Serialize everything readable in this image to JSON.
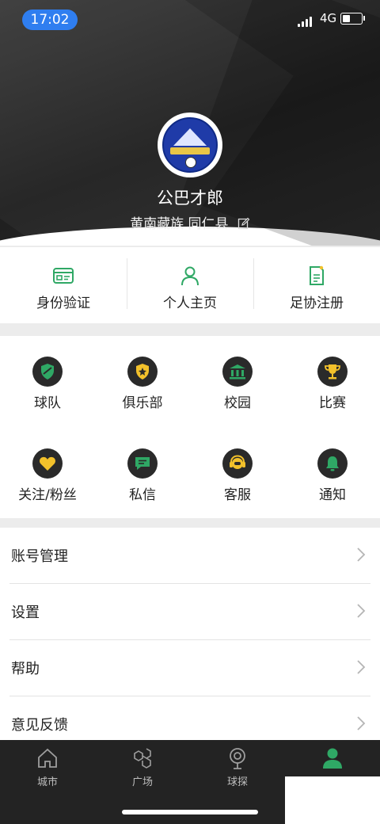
{
  "status": {
    "time": "17:02",
    "network": "4G"
  },
  "profile": {
    "name": "公巴才郎",
    "location": "黄南藏族 同仁县"
  },
  "quick": [
    {
      "label": "身份验证",
      "icon": "id-card-icon"
    },
    {
      "label": "个人主页",
      "icon": "person-icon"
    },
    {
      "label": "足协注册",
      "icon": "register-doc-icon"
    }
  ],
  "grid": [
    {
      "label": "球队",
      "icon": "shield-icon"
    },
    {
      "label": "俱乐部",
      "icon": "club-badge-icon"
    },
    {
      "label": "校园",
      "icon": "school-icon"
    },
    {
      "label": "比赛",
      "icon": "trophy-icon"
    },
    {
      "label": "关注/粉丝",
      "icon": "heart-icon"
    },
    {
      "label": "私信",
      "icon": "message-icon"
    },
    {
      "label": "客服",
      "icon": "headset-icon"
    },
    {
      "label": "通知",
      "icon": "bell-icon"
    }
  ],
  "menu": [
    {
      "label": "账号管理"
    },
    {
      "label": "设置"
    },
    {
      "label": "帮助"
    },
    {
      "label": "意见反馈"
    }
  ],
  "tabs": [
    {
      "label": "城市",
      "icon": "home-icon"
    },
    {
      "label": "广场",
      "icon": "hexagon-icon"
    },
    {
      "label": "球探",
      "icon": "location-target-icon"
    },
    {
      "label": "",
      "icon": "user-icon",
      "active": true
    }
  ],
  "colors": {
    "accent": "#2fa865",
    "dark": "#2a2a2a",
    "yellow": "#f3c12b",
    "status_pill": "#2f7ef0"
  }
}
